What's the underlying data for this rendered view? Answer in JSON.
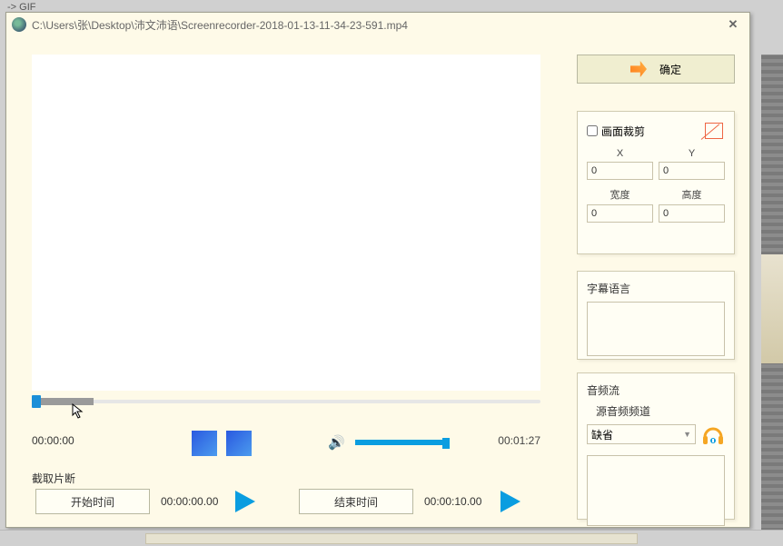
{
  "parent_hint": "-> GIF",
  "title": "C:\\Users\\张\\Desktop\\沛文沛语\\Screenrecorder-2018-01-13-11-34-23-591.mp4",
  "ok_label": "确定",
  "crop": {
    "checkbox_label": "画面裁剪",
    "x_label": "X",
    "y_label": "Y",
    "w_label": "宽度",
    "h_label": "高度",
    "x": "0",
    "y": "0",
    "w": "0",
    "h": "0"
  },
  "subtitle": {
    "label": "字幕语言"
  },
  "audio": {
    "section_label": "音频流",
    "channel_label": "源音频频道",
    "selected": "缺省"
  },
  "player": {
    "current": "00:00:00",
    "total": "00:01:27"
  },
  "clip": {
    "label": "截取片断",
    "start_btn": "开始时间",
    "end_btn": "结束时间",
    "start_val": "00:00:00.00",
    "end_val": "00:00:10.00"
  }
}
